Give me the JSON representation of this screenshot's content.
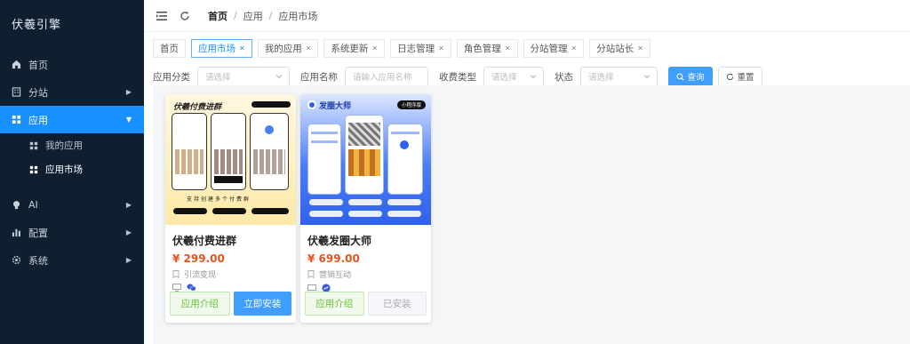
{
  "sidebar": {
    "brand": "伏羲引擎",
    "items": [
      {
        "label": "首页",
        "icon": "home-icon"
      },
      {
        "label": "分站",
        "icon": "building-icon"
      },
      {
        "label": "应用",
        "icon": "apps-icon"
      },
      {
        "label": "AI",
        "icon": "bulb-icon"
      },
      {
        "label": "配置",
        "icon": "chart-icon"
      },
      {
        "label": "系统",
        "icon": "gear-icon"
      }
    ],
    "sub_items": [
      {
        "label": "我的应用"
      },
      {
        "label": "应用市场"
      }
    ]
  },
  "breadcrumb": [
    "首页",
    "应用",
    "应用市场"
  ],
  "tabs": [
    {
      "label": "首页",
      "closable": false
    },
    {
      "label": "应用市场",
      "closable": true,
      "active": true
    },
    {
      "label": "我的应用",
      "closable": true
    },
    {
      "label": "系统更新",
      "closable": true
    },
    {
      "label": "日志管理",
      "closable": true
    },
    {
      "label": "角色管理",
      "closable": true
    },
    {
      "label": "分站管理",
      "closable": true
    },
    {
      "label": "分站站长",
      "closable": true
    }
  ],
  "filters": {
    "category_label": "应用分类",
    "category_placeholder": "请选择",
    "name_label": "应用名称",
    "name_placeholder": "请输入应用名称",
    "fee_label": "收费类型",
    "fee_placeholder": "请选择",
    "status_label": "状态",
    "status_placeholder": "请选择",
    "query_label": "查询",
    "reset_label": "重置"
  },
  "cards": [
    {
      "name": "伏羲付费进群",
      "price": "¥ 299.00",
      "category": "引流变现",
      "banner_title": "伏羲付费进群",
      "banner_caption": "支持创建多个付费群",
      "intro_label": "应用介绍",
      "action_label": "立即安装"
    },
    {
      "name": "伏羲发圈大师",
      "price": "¥ 699.00",
      "category": "营销互动",
      "banner_title": "发圈大师",
      "banner_tag": "小程序版",
      "intro_label": "应用介绍",
      "action_label": "已安装"
    }
  ],
  "colors": {
    "sidebar_bg": "#0f1f30",
    "accent": "#409eff",
    "price": "#e6521d",
    "intro_green": "#67c23a"
  }
}
